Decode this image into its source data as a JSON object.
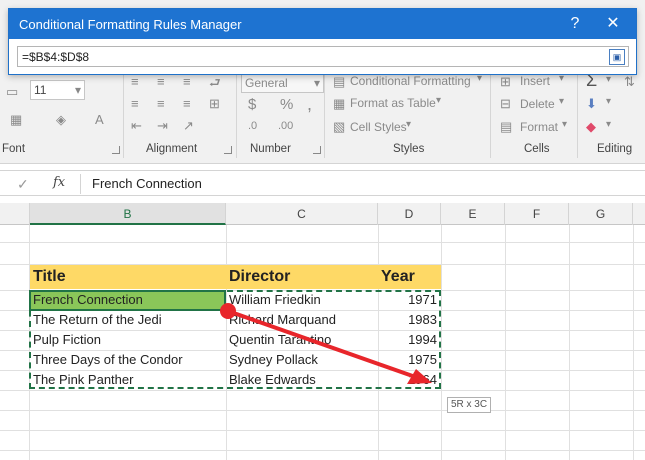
{
  "dialog": {
    "title": "Conditional Formatting Rules Manager",
    "help_label": "?",
    "close_label": "✕",
    "range_value": "=$B$4:$D$8",
    "collapse_icon": "restore-dialog-icon"
  },
  "ribbon": {
    "font_size": "11",
    "number_format": "General",
    "currency_symbol": "$",
    "percent_symbol": "%",
    "comma_symbol": ",",
    "conditional_formatting": "Conditional Formatting",
    "format_as_table": "Format as Table",
    "cell_styles": "Cell Styles",
    "insert": "Insert",
    "delete": "Delete",
    "format": "Format",
    "groups": {
      "font": "Font",
      "alignment": "Alignment",
      "number": "Number",
      "styles": "Styles",
      "cells": "Cells",
      "editing": "Editing"
    }
  },
  "formula_bar": {
    "cancel_label": "✓",
    "fx_label": "fx",
    "value": "French Connection"
  },
  "columns": [
    "B",
    "C",
    "D",
    "E",
    "F",
    "G"
  ],
  "table": {
    "headers": [
      "Title",
      "Director",
      "Year"
    ],
    "rows": [
      [
        "French Connection",
        "William Friedkin",
        "1971"
      ],
      [
        "The Return of the Jedi",
        "Richard Marquand",
        "1983"
      ],
      [
        "Pulp Fiction",
        "Quentin Tarantino",
        "1994"
      ],
      [
        "Three Days of the Condor",
        "Sydney Pollack",
        "1975"
      ],
      [
        "The Pink Panther",
        "Blake Edwards",
        "1964"
      ]
    ]
  },
  "selection_size": "5R x 3C",
  "colors": {
    "header_fill": "#fed966",
    "active_fill": "#8ac659",
    "selection_border": "#217346",
    "dialog_titlebar": "#1e73d1",
    "arrow": "#e8262b"
  }
}
